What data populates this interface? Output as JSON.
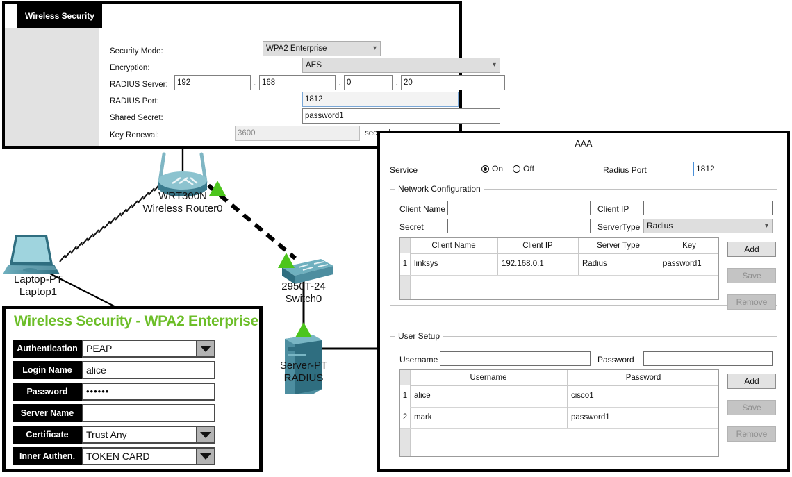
{
  "wireless_security_panel": {
    "tab_label": "Wireless Security",
    "fields": {
      "security_mode_label": "Security Mode:",
      "security_mode_value": "WPA2 Enterprise",
      "encryption_label": "Encryption:",
      "encryption_value": "AES",
      "radius_server_label": "RADIUS Server:",
      "radius_server_octet1": "192",
      "radius_server_octet2": "168",
      "radius_server_octet3": "0",
      "radius_server_octet4": "20",
      "octet_separator": ".",
      "radius_port_label": "RADIUS Port:",
      "radius_port_value": "1812",
      "shared_secret_label": "Shared Secret:",
      "shared_secret_value": "password1",
      "key_renewal_label": "Key Renewal:",
      "key_renewal_value": "3600",
      "key_renewal_unit": "seconds"
    }
  },
  "topology": {
    "devices": [
      {
        "name": "wireless-router",
        "model": "WRT300N",
        "label": "Wireless Router0"
      },
      {
        "name": "laptop",
        "model": "Laptop-PT",
        "label": "Laptop1"
      },
      {
        "name": "switch",
        "model": "2950T-24",
        "label": "Switch0"
      },
      {
        "name": "server",
        "model": "Server-PT",
        "label": "RADIUS"
      }
    ]
  },
  "wpa2_supplicant_panel": {
    "title": "Wireless Security - WPA2 Enterprise",
    "rows": [
      {
        "label": "Authentication",
        "value": "PEAP",
        "type": "dropdown"
      },
      {
        "label": "Login Name",
        "value": "alice",
        "type": "text"
      },
      {
        "label": "Password",
        "value": "••••••",
        "type": "password"
      },
      {
        "label": "Server Name",
        "value": "",
        "type": "text"
      },
      {
        "label": "Certificate",
        "value": "Trust Any",
        "type": "dropdown"
      },
      {
        "label": "Inner Authen.",
        "value": "TOKEN CARD",
        "type": "dropdown"
      }
    ]
  },
  "aaa_panel": {
    "title": "AAA",
    "service_label": "Service",
    "service_on_label": "On",
    "service_off_label": "Off",
    "service_selected": "On",
    "radius_port_label": "Radius Port",
    "radius_port_value": "1812",
    "network_configuration": {
      "group_title": "Network Configuration",
      "client_name_label": "Client Name",
      "client_name_value": "",
      "client_ip_label": "Client IP",
      "client_ip_value": "",
      "secret_label": "Secret",
      "secret_value": "",
      "server_type_label": "ServerType",
      "server_type_value": "Radius",
      "columns": [
        "Client Name",
        "Client IP",
        "Server Type",
        "Key"
      ],
      "rows": [
        {
          "index": "1",
          "client_name": "linksys",
          "client_ip": "192.168.0.1",
          "server_type": "Radius",
          "key": "password1"
        }
      ],
      "buttons": [
        {
          "label": "Add",
          "enabled": true
        },
        {
          "label": "Save",
          "enabled": false
        },
        {
          "label": "Remove",
          "enabled": false
        }
      ]
    },
    "user_setup": {
      "group_title": "User Setup",
      "username_label": "Username",
      "username_value": "",
      "password_label": "Password",
      "password_value": "",
      "columns": [
        "Username",
        "Password"
      ],
      "rows": [
        {
          "index": "1",
          "username": "alice",
          "password": "cisco1"
        },
        {
          "index": "2",
          "username": "mark",
          "password": "password1"
        }
      ],
      "buttons": [
        {
          "label": "Add",
          "enabled": true
        },
        {
          "label": "Save",
          "enabled": false
        },
        {
          "label": "Remove",
          "enabled": false
        }
      ]
    }
  },
  "colors": {
    "brand_green": "#6cbe28",
    "device_teal": "#3f7f94",
    "link_green": "#4cc51c",
    "focus_blue": "#4a90d9"
  }
}
